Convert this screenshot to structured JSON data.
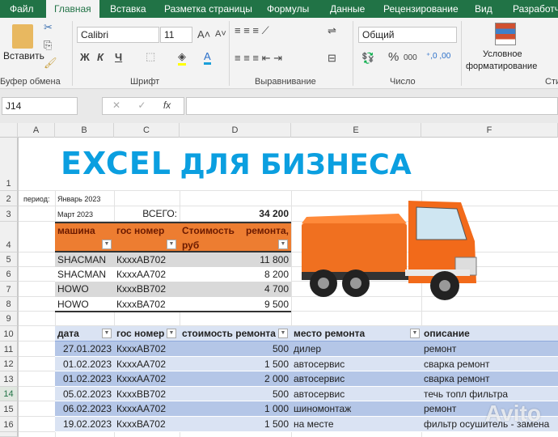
{
  "tabs": [
    "Файл",
    "Главная",
    "Вставка",
    "Разметка страницы",
    "Формулы",
    "Данные",
    "Рецензирование",
    "Вид",
    "Разработчик"
  ],
  "ribbon": {
    "paste": "Вставить",
    "clipboard": "Буфер обмена",
    "font_group": "Шрифт",
    "font": "Calibri",
    "size": "11",
    "bold": "Ж",
    "italic": "К",
    "underline": "Ч",
    "align_group": "Выравнивание",
    "number_format": "Общий",
    "number_group": "Число",
    "percent": "%",
    "thousands": "000",
    "cond_format_1": "Условное",
    "cond_format_2": "форматирование",
    "styles_group": "Стили",
    "fx": "fx"
  },
  "namebox": "J14",
  "columns": [
    "A",
    "B",
    "C",
    "D",
    "E",
    "F"
  ],
  "rows": [
    "1",
    "2",
    "3",
    "4",
    "5",
    "6",
    "7",
    "8",
    "9",
    "10",
    "11",
    "12",
    "13",
    "14",
    "15",
    "16"
  ],
  "title": {
    "excel": "EXCEL",
    "rest": "ДЛЯ БИЗНЕСА"
  },
  "period_label": "период:",
  "period_from": "Январь 2023",
  "period_to": "Март 2023",
  "total_label": "ВСЕГО:",
  "total_value": "34 200",
  "summary": {
    "headers": [
      "машина",
      "гос номер",
      "Стоимость ремонта,",
      "руб"
    ],
    "rows": [
      [
        "SHACMAN",
        "КхххАВ702",
        "11 800"
      ],
      [
        "SHACMAN",
        "КхххАА702",
        "8 200"
      ],
      [
        "HOWO",
        "КхххВВ702",
        "4 700"
      ],
      [
        "HOWO",
        "КхххВА702",
        "9 500"
      ]
    ]
  },
  "log": {
    "headers": [
      "дата",
      "гос номер",
      "стоимость ремонта",
      "место ремонта",
      "описание"
    ],
    "rows": [
      [
        "27.01.2023",
        "КхххАВ702",
        "500",
        "дилер",
        "ремонт"
      ],
      [
        "01.02.2023",
        "КхххАА702",
        "1 500",
        "автосервис",
        "сварка ремонт"
      ],
      [
        "01.02.2023",
        "КхххАА702",
        "2 000",
        "автосервис",
        "сварка ремонт"
      ],
      [
        "05.02.2023",
        "КхххВВ702",
        "500",
        "автосервис",
        "течь топл фильтра"
      ],
      [
        "06.02.2023",
        "КхххАА702",
        "1 000",
        "шиномонтаж",
        "ремонт"
      ],
      [
        "19.02.2023",
        "КхххВА702",
        "1 500",
        "на месте",
        "фильтр осушитель - замена"
      ]
    ]
  },
  "watermark": "Avito",
  "colors": {
    "excel_green": "#217346",
    "title_blue": "#0b9fe0",
    "header_orange": "#ed7d31",
    "band_blue": "#b4c6e7",
    "band_light": "#dae3f3"
  }
}
